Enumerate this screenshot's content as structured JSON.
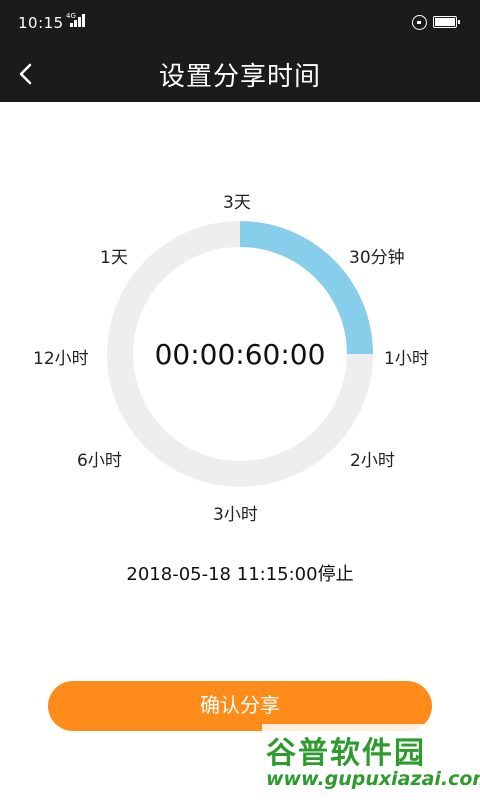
{
  "status_bar": {
    "time": "10:15",
    "network": "4G"
  },
  "header": {
    "title": "设置分享时间"
  },
  "dial": {
    "labels": [
      "3天",
      "30分钟",
      "1小时",
      "2小时",
      "3小时",
      "6小时",
      "12小时",
      "1天"
    ],
    "countdown": "00:00:60:00",
    "progress_fraction": 0.25,
    "track_color": "#eeeeee",
    "progress_color": "#87ceeb"
  },
  "stop_time": "2018-05-18 11:15:00停止",
  "confirm_label": "确认分享",
  "accent_color": "#ff8c1a",
  "watermark": {
    "text": "谷普软件园",
    "url_text": "www.gupuxiazai.com"
  }
}
